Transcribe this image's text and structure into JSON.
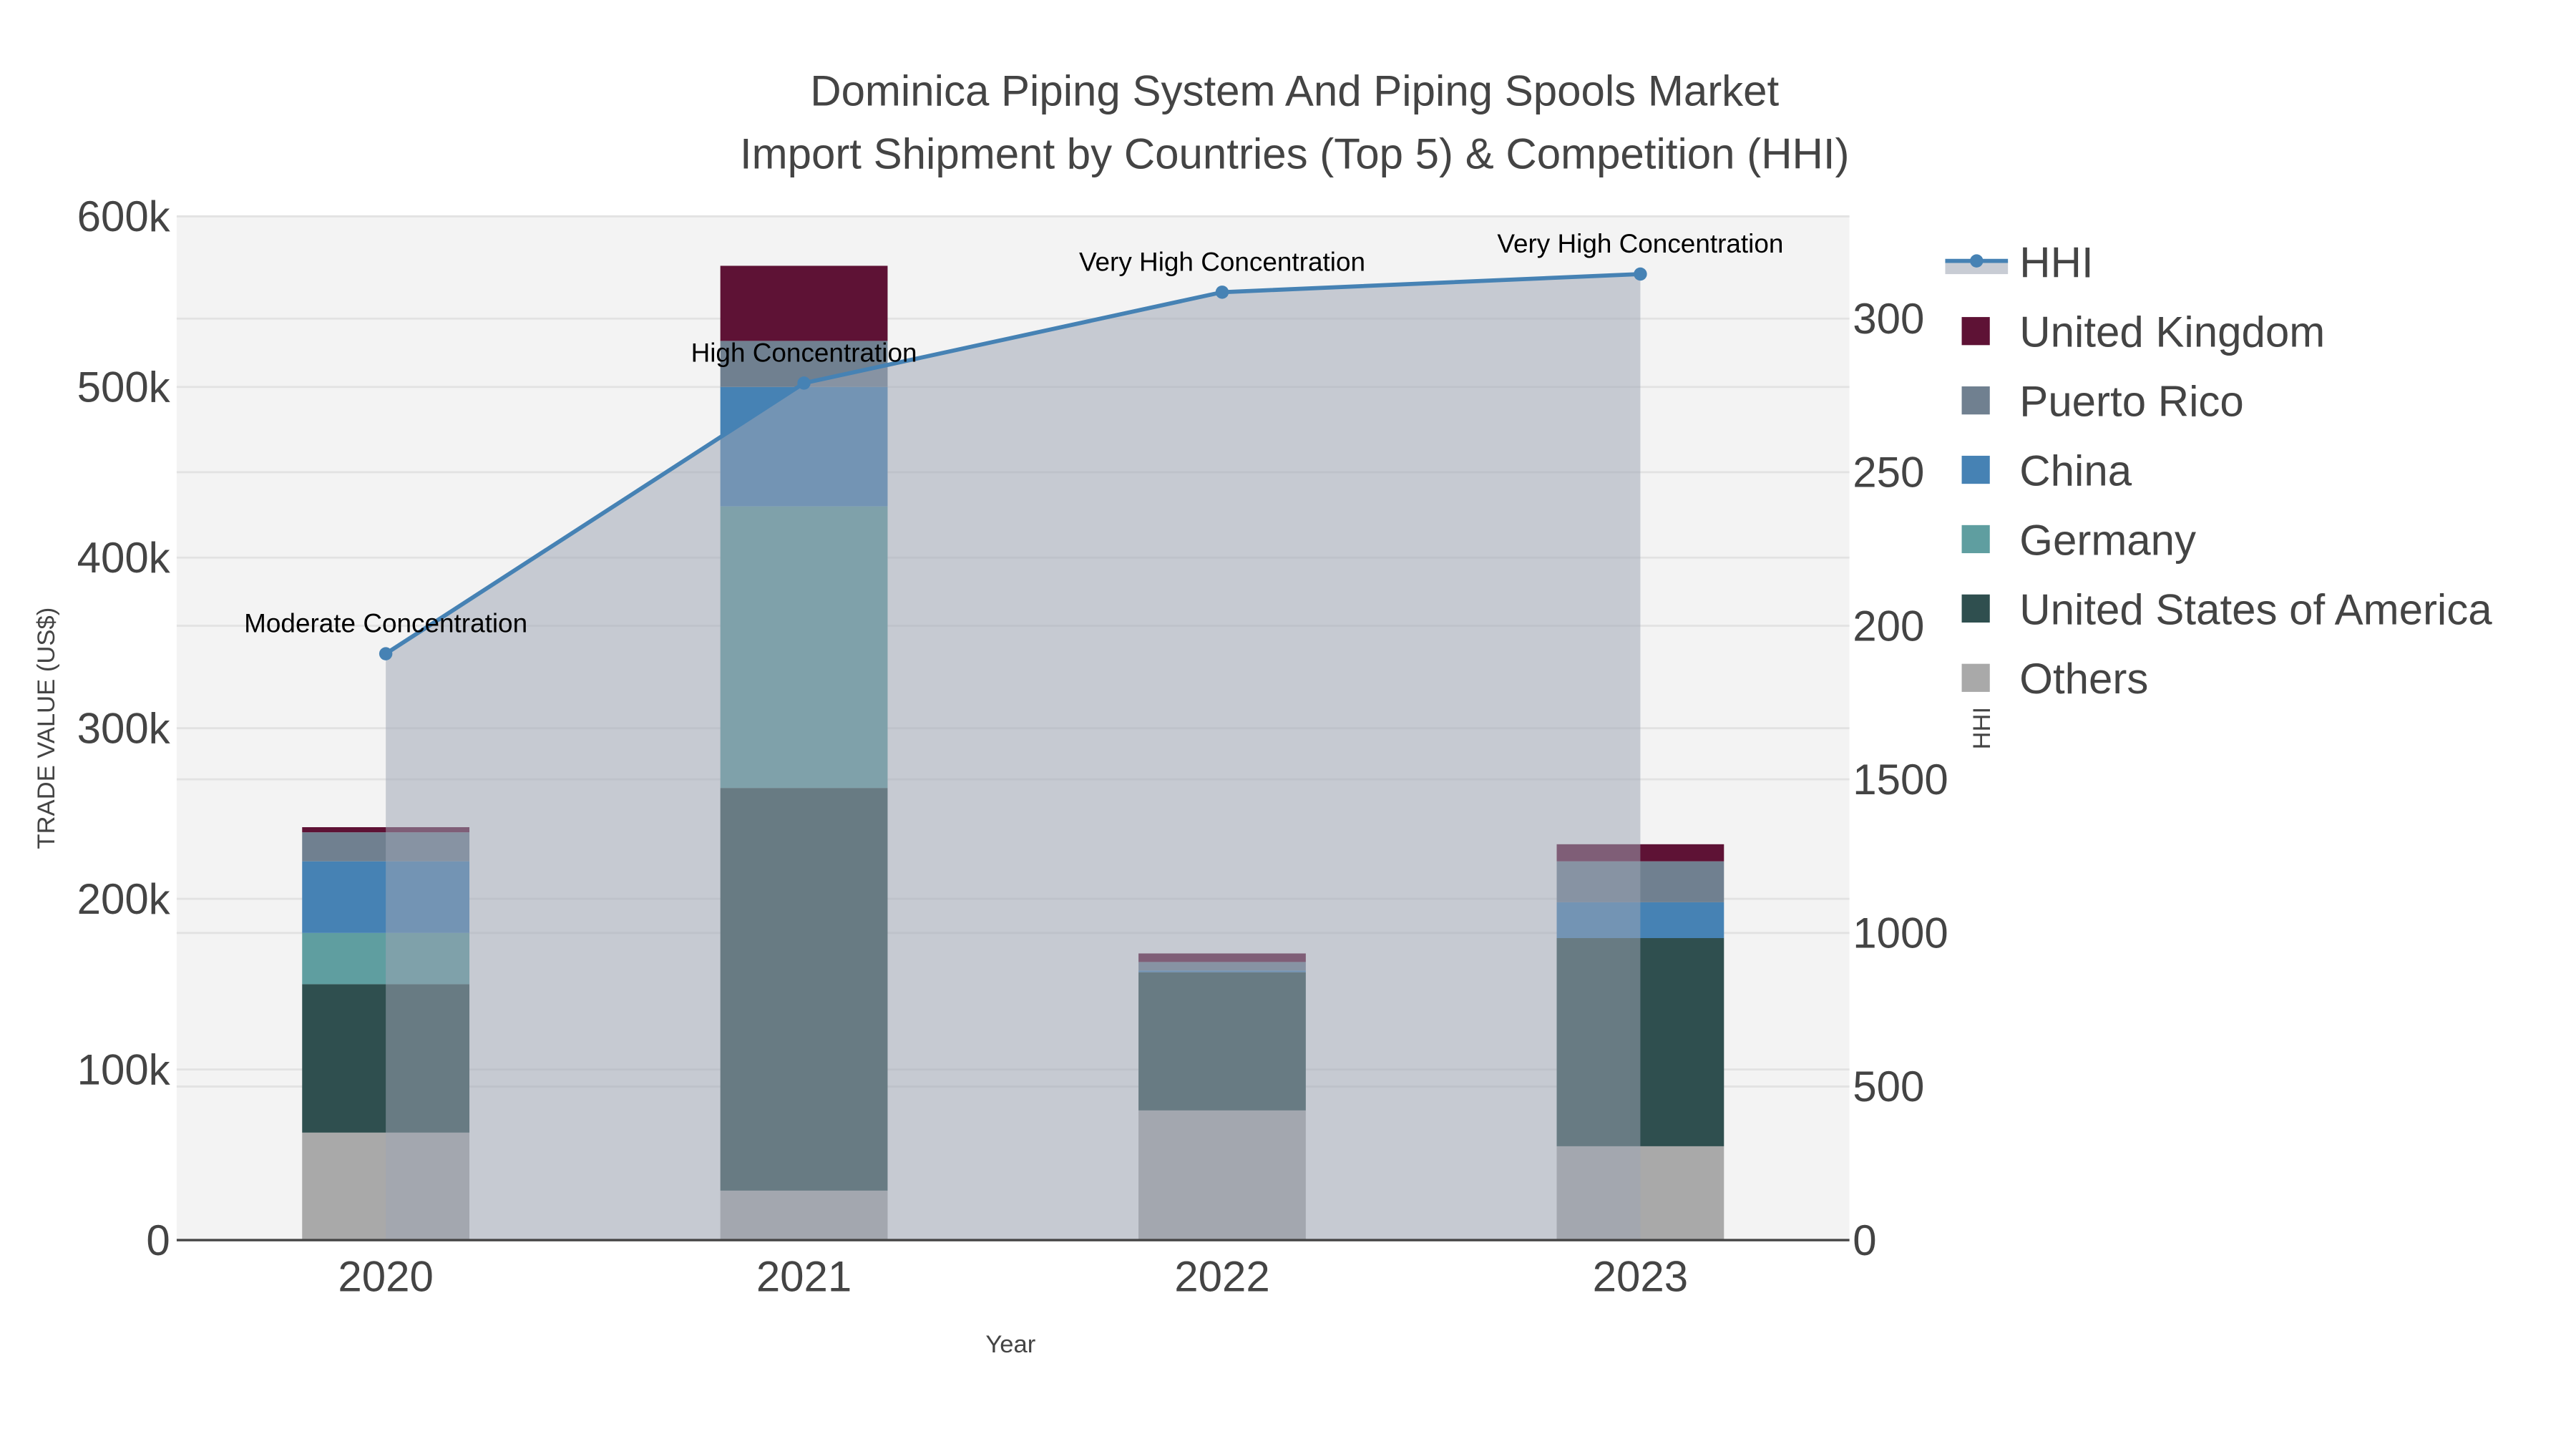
{
  "chart_data": {
    "type": "bar",
    "title_line1": "Dominica Piping System And Piping Spools Market",
    "title_line2": "Import Shipment by Countries (Top 5) & Competition (HHI)",
    "xlabel": "Year",
    "ylabel": "TRADE VALUE (US$)",
    "y2label": "HHI",
    "categories": [
      "2020",
      "2021",
      "2022",
      "2023"
    ],
    "ylim": [
      0,
      600000
    ],
    "y_ticks": [
      0,
      100000,
      200000,
      300000,
      400000,
      500000,
      600000
    ],
    "y_tick_labels": [
      "0",
      "100k",
      "200k",
      "300k",
      "400k",
      "500k",
      "600k"
    ],
    "y2lim": [
      0,
      3333
    ],
    "y2_ticks": [
      0,
      500,
      1000,
      1500,
      2000,
      2500,
      3000
    ],
    "y2_tick_labels": [
      "0",
      "500",
      "1000",
      "1500",
      "200",
      "250",
      "300"
    ],
    "series": [
      {
        "name": "Others",
        "color": "#A9A9A9",
        "values": [
          63000,
          29000,
          76000,
          55000
        ]
      },
      {
        "name": "United States of America",
        "color": "#2F4F4F",
        "values": [
          87000,
          236000,
          81000,
          122000
        ]
      },
      {
        "name": "Germany",
        "color": "#5F9EA0",
        "values": [
          30000,
          165000,
          0,
          0
        ]
      },
      {
        "name": "China",
        "color": "#4682B4",
        "values": [
          42000,
          70000,
          1000,
          21000
        ]
      },
      {
        "name": "Puerto Rico",
        "color": "#708090",
        "values": [
          17000,
          27000,
          5000,
          24000
        ]
      },
      {
        "name": "United Kingdom",
        "color": "#5E1235",
        "values": [
          3000,
          44000,
          5000,
          10000
        ]
      }
    ],
    "hhi": {
      "name": "HHI",
      "color": "#4682B4",
      "values": [
        1909,
        2790,
        3086,
        3145
      ],
      "annotations": [
        "Moderate Concentration",
        "High Concentration",
        "Very High Concentration",
        "Very High Concentration"
      ]
    },
    "legend_order": [
      "HHI",
      "United Kingdom",
      "Puerto Rico",
      "China",
      "Germany",
      "United States of America",
      "Others"
    ],
    "legend_position": "right",
    "grid": true
  }
}
